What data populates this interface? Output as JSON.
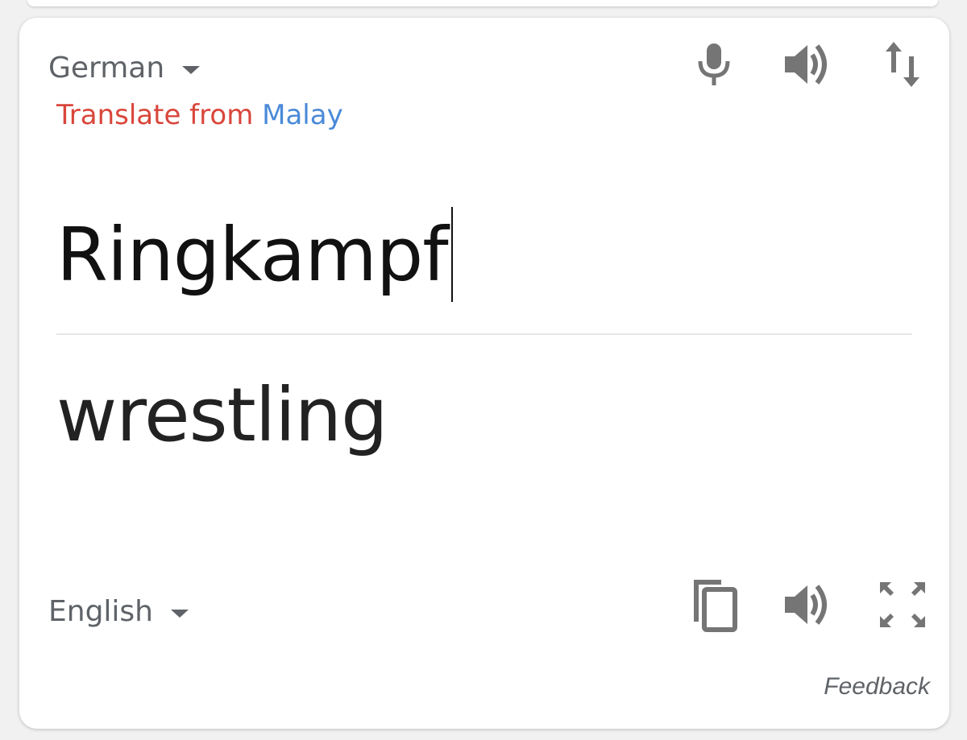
{
  "source": {
    "language": "German",
    "detected_prefix": "Translate from",
    "detected_language": "Malay",
    "text": "Ringkampf"
  },
  "target": {
    "language": "English",
    "text": "wrestling"
  },
  "icons": {
    "source_actions": [
      "microphone-icon",
      "speaker-icon",
      "swap-languages-icon"
    ],
    "target_actions": [
      "copy-icon",
      "speaker-icon",
      "fullscreen-icon"
    ]
  },
  "footer": {
    "feedback_label": "Feedback"
  },
  "colors": {
    "translate_from": "#d9463b",
    "detected_language_link": "#4a8ad8",
    "icon": "#757575"
  }
}
